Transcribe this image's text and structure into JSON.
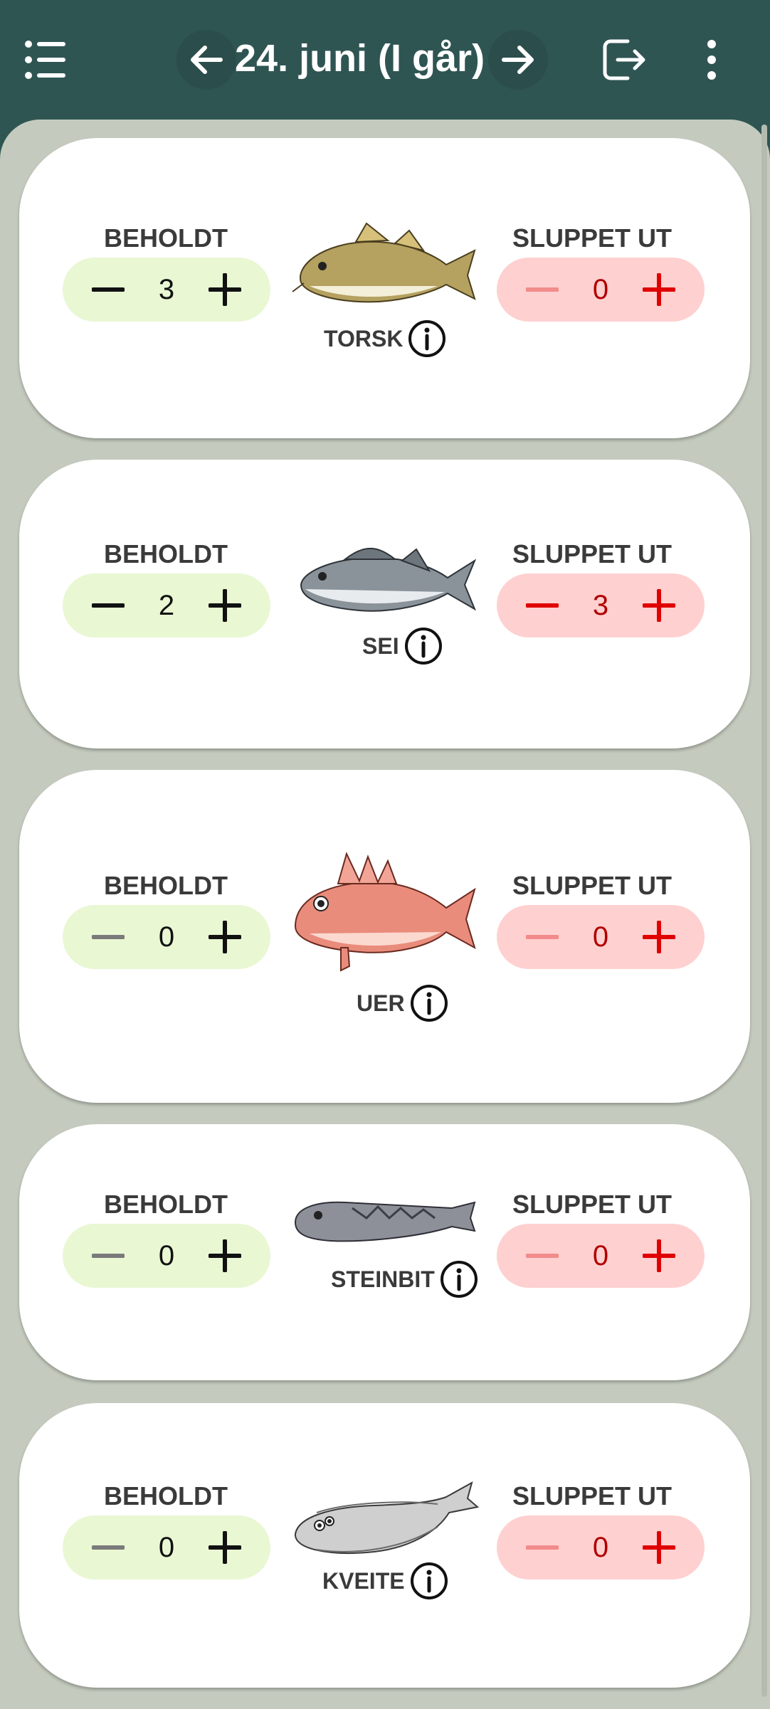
{
  "header": {
    "title": "24. juni (I går)",
    "icons": {
      "menu": "list-menu-icon",
      "prev": "arrow-left-icon",
      "next": "arrow-right-icon",
      "logout": "logout-icon",
      "more": "more-vertical-icon"
    }
  },
  "colors": {
    "header_bg": "#2f5553",
    "content_bg": "#c4cbbe",
    "kept_bg": "#e9f7d3",
    "released_bg": "#ffd0d0",
    "released_accent": "#e00000"
  },
  "labels": {
    "kept": "BEHOLDT",
    "released": "SLUPPET UT"
  },
  "species": [
    {
      "name": "TORSK",
      "kept": "3",
      "released": "0"
    },
    {
      "name": "SEI",
      "kept": "2",
      "released": "3"
    },
    {
      "name": "UER",
      "kept": "0",
      "released": "0"
    },
    {
      "name": "STEINBIT",
      "kept": "0",
      "released": "0"
    },
    {
      "name": "KVEITE",
      "kept": "0",
      "released": "0"
    }
  ]
}
